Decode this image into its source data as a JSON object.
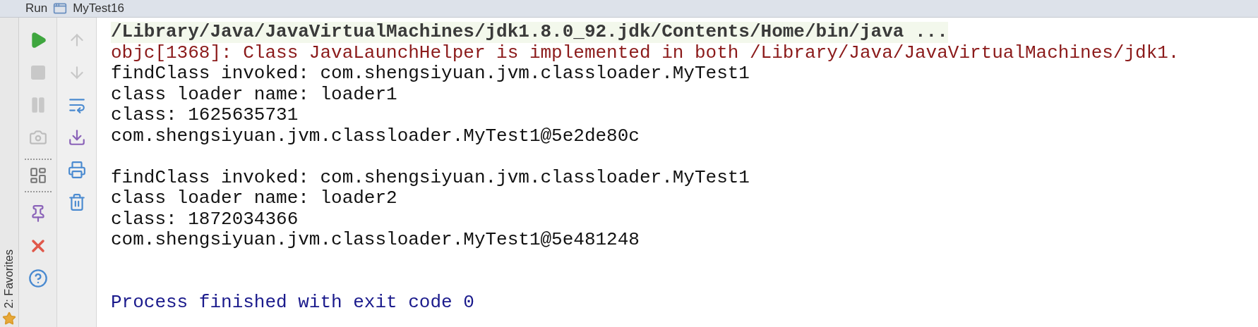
{
  "panel": {
    "title": "Run",
    "config": "MyTest16"
  },
  "side_tab": {
    "label": "2: Favorites"
  },
  "console": {
    "lines": [
      {
        "kind": "command",
        "text": "/Library/Java/JavaVirtualMachines/jdk1.8.0_92.jdk/Contents/Home/bin/java ..."
      },
      {
        "kind": "error",
        "text": "objc[1368]: Class JavaLaunchHelper is implemented in both /Library/Java/JavaVirtualMachines/jdk1."
      },
      {
        "kind": "output",
        "text": "findClass invoked: com.shengsiyuan.jvm.classloader.MyTest1"
      },
      {
        "kind": "output",
        "text": "class loader name: loader1"
      },
      {
        "kind": "output",
        "text": "class: 1625635731"
      },
      {
        "kind": "output",
        "text": "com.shengsiyuan.jvm.classloader.MyTest1@5e2de80c"
      },
      {
        "kind": "blank"
      },
      {
        "kind": "output",
        "text": "findClass invoked: com.shengsiyuan.jvm.classloader.MyTest1"
      },
      {
        "kind": "output",
        "text": "class loader name: loader2"
      },
      {
        "kind": "output",
        "text": "class: 1872034366"
      },
      {
        "kind": "output",
        "text": "com.shengsiyuan.jvm.classloader.MyTest1@5e481248"
      },
      {
        "kind": "blank"
      },
      {
        "kind": "blank"
      },
      {
        "kind": "exit",
        "text": "Process finished with exit code 0"
      }
    ]
  }
}
